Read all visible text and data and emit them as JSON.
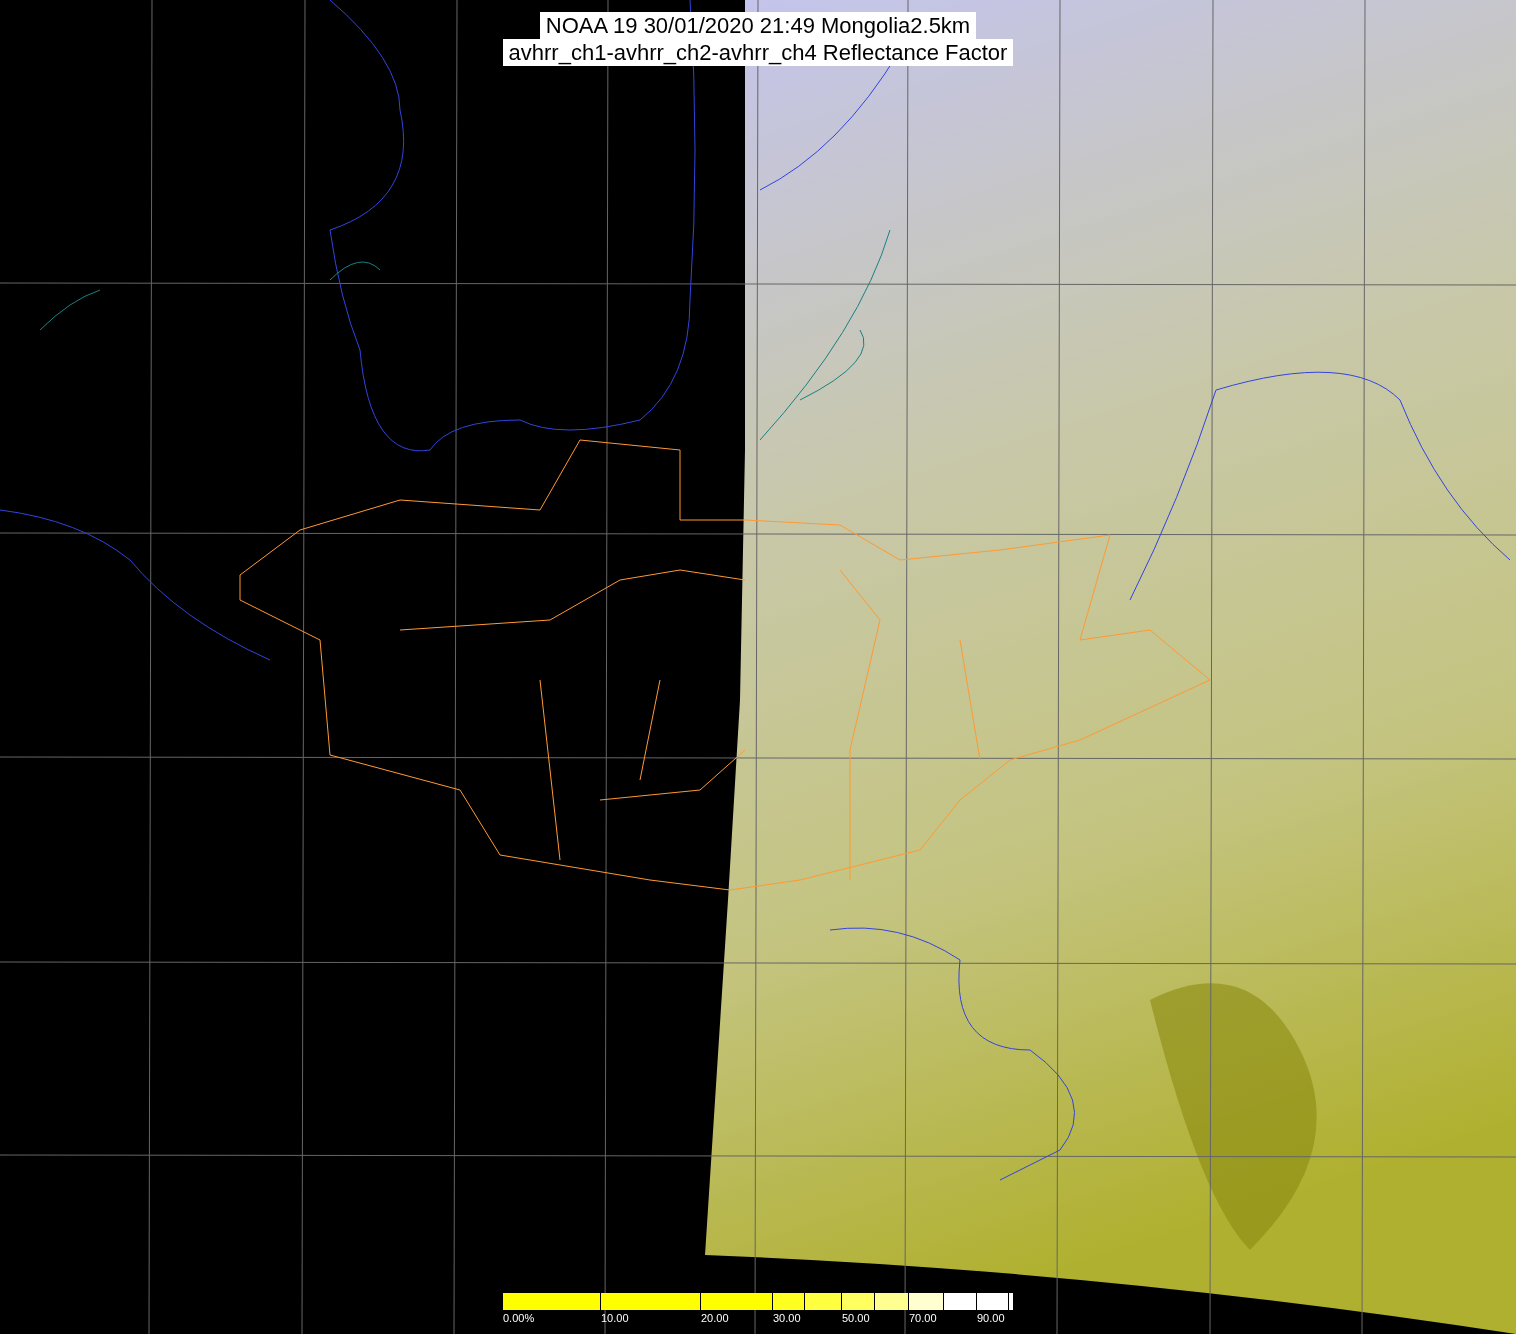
{
  "title": {
    "lines": [
      "NOAA 19 30/01/2020 21:49 Mongolia2.5km",
      "avhrr_ch1-avhrr_ch2-avhrr_ch4 Reflectance Factor"
    ]
  },
  "colorbar": {
    "segments": [
      {
        "color": "#ffff00"
      },
      {
        "color": "#ffff00"
      },
      {
        "color": "#ffff00"
      },
      {
        "color": "#ffff20"
      },
      {
        "color": "#ffff40"
      },
      {
        "color": "#ffff60"
      },
      {
        "color": "#ffff90"
      },
      {
        "color": "#ffffd0"
      },
      {
        "color": "#ffffff"
      },
      {
        "color": "#ffffff"
      },
      {
        "color": "#ffffff"
      }
    ],
    "labels": [
      "0.00%",
      "10.00",
      "20.00",
      "30.00",
      "50.00",
      "70.00",
      "90.00"
    ]
  }
}
